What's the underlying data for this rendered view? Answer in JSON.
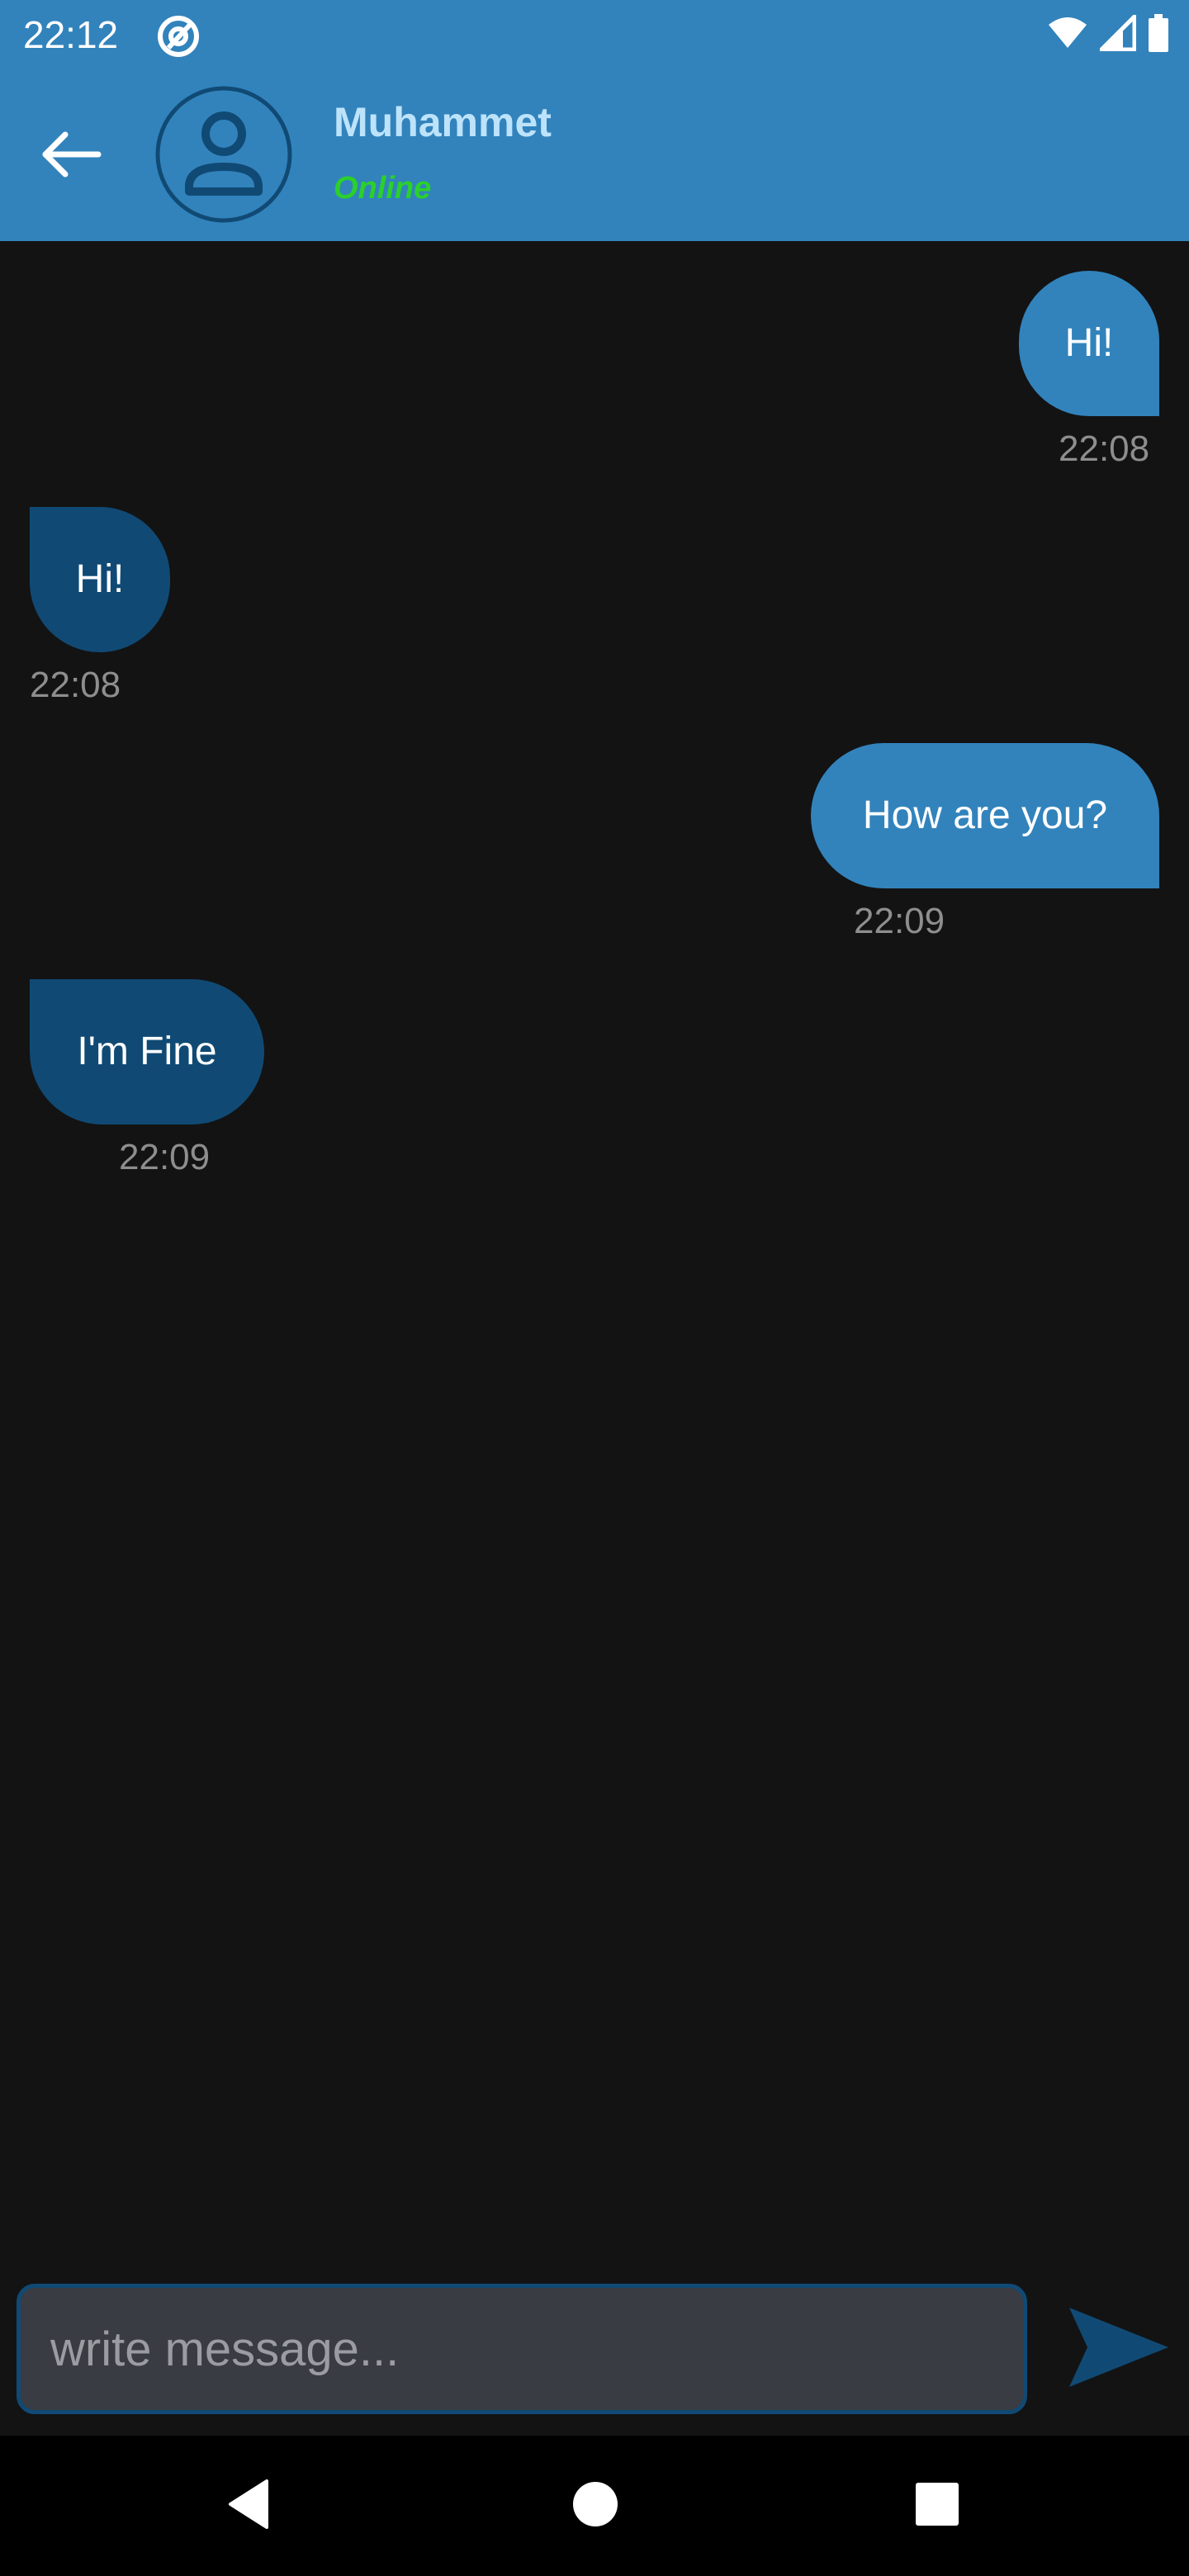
{
  "status_bar": {
    "time": "22:12",
    "icons": [
      "app-notification-icon",
      "wifi-icon",
      "signal-icon",
      "battery-icon"
    ]
  },
  "header": {
    "back_icon": "arrow-left-icon",
    "avatar_icon": "person-icon",
    "contact_name": "Muhammet",
    "contact_status": "Online"
  },
  "messages": [
    {
      "direction": "sent",
      "text": "Hi!",
      "time": "22:08"
    },
    {
      "direction": "received",
      "text": "Hi!",
      "time": "22:08"
    },
    {
      "direction": "sent",
      "text": "How are you?",
      "time": "22:09"
    },
    {
      "direction": "received",
      "text": "I'm Fine",
      "time": "22:09"
    }
  ],
  "composer": {
    "value": "",
    "placeholder": "write message...",
    "send_icon": "send-icon"
  },
  "nav_bar": {
    "icons": [
      "back-triangle-icon",
      "home-circle-icon",
      "recents-square-icon"
    ]
  },
  "colors": {
    "primary": "#3283bc",
    "received_bubble": "#104a74",
    "background": "#131314",
    "online": "#2bd02b",
    "contact_name": "#bde3fb",
    "timestamp": "#8e8e8e"
  }
}
